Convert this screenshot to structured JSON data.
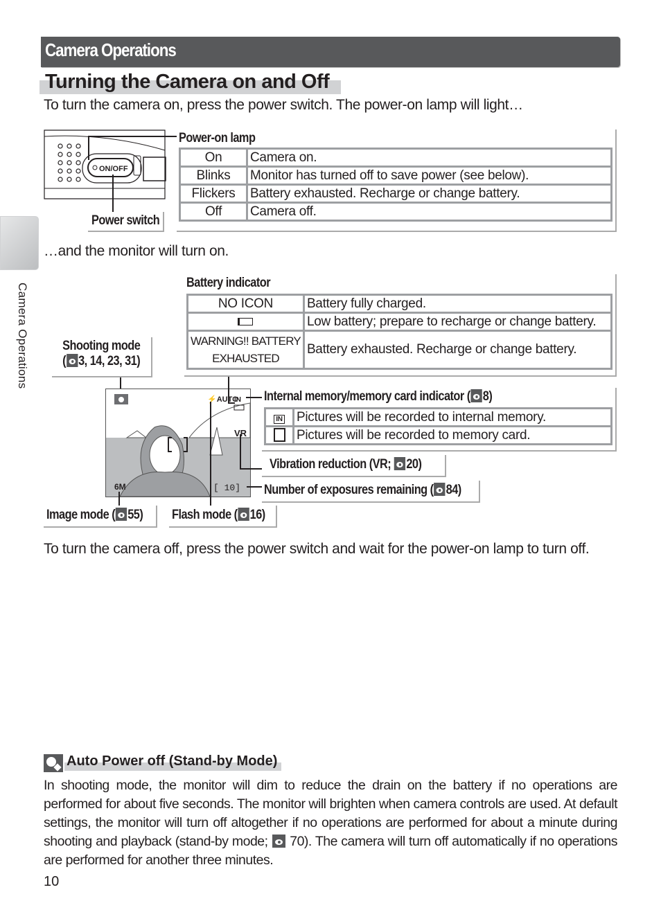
{
  "header": {
    "title": "Camera Operations"
  },
  "section": {
    "title": "Turning the Camera on and Off"
  },
  "intro": "To turn the camera on, press the power switch.  The power-on lamp will light…",
  "power_switch_label": "Power switch",
  "power_button_text": "ON/OFF",
  "power_lamp": {
    "title": "Power-on lamp",
    "rows": [
      {
        "state": "On",
        "desc": "Camera on."
      },
      {
        "state": "Blinks",
        "desc": "Monitor has turned off to save power (see below)."
      },
      {
        "state": "Flickers",
        "desc": "Battery exhausted.  Recharge or change battery."
      },
      {
        "state": "Off",
        "desc": "Camera off."
      }
    ]
  },
  "monitor_on": "…and the monitor will turn on.",
  "battery": {
    "title": "Battery indicator",
    "rows": [
      {
        "state": "NO ICON",
        "desc": "Battery fully charged."
      },
      {
        "state": "low-battery-icon",
        "desc": "Low battery; prepare to recharge or change battery."
      },
      {
        "state": "WARNING!! BATTERY EXHAUSTED",
        "state_line1": "WARNING!! BATTERY",
        "state_line2": "EXHAUSTED",
        "desc": "Battery exhausted.  Recharge or change battery."
      }
    ]
  },
  "shooting_mode": {
    "line1": "Shooting mode",
    "open": "(",
    "refs": "3, 14, 23, 31)"
  },
  "memory": {
    "title": "Internal memory/memory card indicator (",
    "ref": "8)",
    "rows": [
      {
        "icon": "internal-memory-icon",
        "desc": "Pictures will be recorded to internal memory."
      },
      {
        "icon": "memory-card-icon",
        "desc": "Pictures will be recorded to memory card."
      }
    ]
  },
  "vr": {
    "label": "Vibration reduction (VR; ",
    "ref": "20)"
  },
  "exposures": {
    "label": "Number of exposures remaining (",
    "ref": "84)"
  },
  "image_mode": {
    "label": "Image mode (",
    "ref": "55)"
  },
  "flash_mode": {
    "label": "Flash mode (",
    "ref": "16)"
  },
  "lcd": {
    "flash": "⚡AUTO",
    "image_size": "6M",
    "exposures": "[    10]",
    "vr": "VR",
    "in": "IN"
  },
  "turn_off": "To turn the camera off, press the power switch and wait for the power-on lamp to turn off.",
  "note": {
    "title": "Auto Power off (Stand-by Mode)",
    "body_a": "In shooting mode,  the monitor will dim to reduce the drain on the battery if no operations are performed for about five seconds.  The monitor will brighten when camera controls are used.  At default settings, the monitor will turn off altogether if no operations are performed for about a minute during shooting and playback (stand-by mode; ",
    "body_b": " 70).  The camera will turn off automatically if no operations are performed for another three minutes."
  },
  "side_tab": "Camera Operations",
  "page_number": "10",
  "colors": {
    "header_bg": "#58595b",
    "highlight": "#d1d2d4",
    "table_border": "#9d9fa2"
  }
}
